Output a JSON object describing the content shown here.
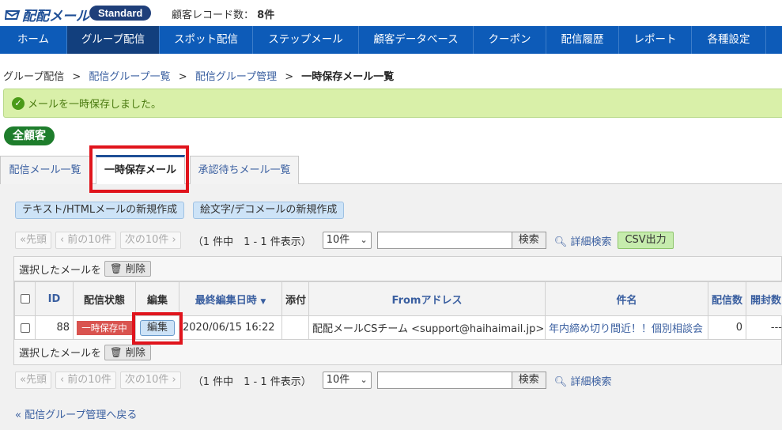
{
  "app": {
    "logo_text": "配配メール",
    "plan": "Standard",
    "record_label": "顧客レコード数：",
    "record_count": "8件"
  },
  "nav": [
    {
      "label": "ホーム",
      "active": false
    },
    {
      "label": "グループ配信",
      "active": true
    },
    {
      "label": "スポット配信",
      "active": false
    },
    {
      "label": "ステップメール",
      "active": false
    },
    {
      "label": "顧客データベース",
      "active": false
    },
    {
      "label": "クーポン",
      "active": false
    },
    {
      "label": "配信履歴",
      "active": false
    },
    {
      "label": "レポート",
      "active": false
    },
    {
      "label": "各種設定",
      "active": false
    }
  ],
  "breadcrumb": {
    "items": [
      "グループ配信",
      "配信グループ一覧",
      "配信グループ管理"
    ],
    "current": "一時保存メール一覧",
    "separator": ">"
  },
  "alert": {
    "message": "メールを一時保存しました。"
  },
  "segment": "全顧客",
  "tabs": [
    {
      "label": "配信メール一覧",
      "active": false
    },
    {
      "label": "一時保存メール",
      "active": true
    },
    {
      "label": "承認待ちメール一覧",
      "active": false
    }
  ],
  "create_buttons": {
    "text_html": "テキスト/HTMLメールの新規作成",
    "deco": "絵文字/デコメールの新規作成"
  },
  "pager": {
    "first": "«先頭",
    "prev": "‹ 前の10件",
    "next": "次の10件 ›",
    "info": "（1 件中　1 - 1 件表示）",
    "per_page": "10件",
    "search_button": "検索",
    "advanced_search": "詳細検索",
    "csv": "CSV出力"
  },
  "bulk": {
    "label": "選択したメールを",
    "delete": "削除"
  },
  "table": {
    "headers": {
      "id": "ID",
      "status": "配信状態",
      "edit": "編集",
      "updated": "最終編集日時",
      "attach": "添付",
      "from": "Fromアドレス",
      "subject": "件名",
      "sent": "配信数",
      "opened": "開封数"
    },
    "rows": [
      {
        "id": "88",
        "status": "一時保存中",
        "edit": "編集",
        "updated": "2020/06/15 16:22",
        "attach": "",
        "from": "配配メールCSチーム <support@haihaimail.jp>",
        "subject": "年内締め切り間近！！個別相談会",
        "sent": "0",
        "opened": "---"
      }
    ]
  },
  "back_link": "配信グループ管理へ戻る",
  "colors": {
    "nav_bg": "#0d5bb8",
    "nav_active": "#123f7d",
    "alert_bg": "#d9f0a9",
    "segment_badge": "#1e7d2c",
    "status_badge": "#d9534f",
    "highlight": "#e0141c"
  },
  "icons": {
    "logo": "mail-envelope-icon",
    "alert": "check-circle-icon",
    "delete": "trash-icon",
    "search": "magnifier-icon",
    "sort": "caret-down-icon",
    "back": "double-chevron-left-icon"
  }
}
